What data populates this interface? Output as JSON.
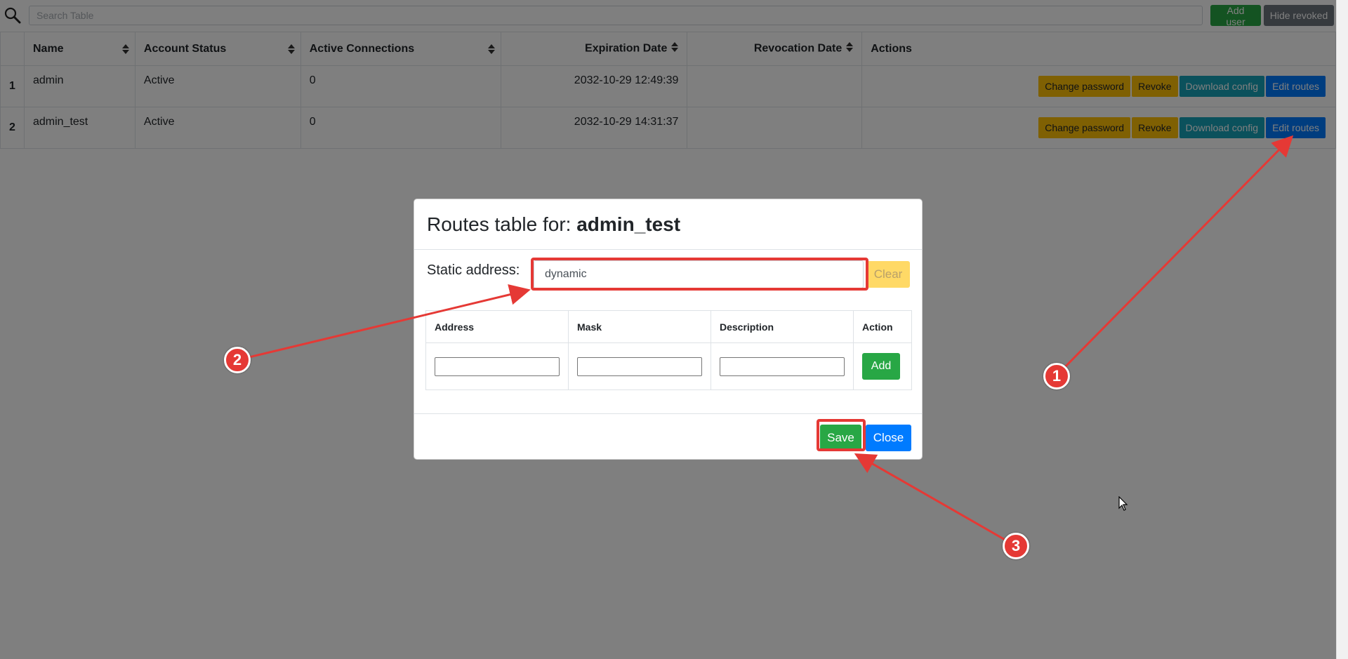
{
  "toolbar": {
    "search_placeholder": "Search Table",
    "add_user_label": "Add user",
    "hide_revoked_label": "Hide revoked"
  },
  "users_table": {
    "columns": [
      "Name",
      "Account Status",
      "Active Connections",
      "Expiration Date",
      "Revocation Date",
      "Actions"
    ],
    "rows": [
      {
        "index": "1",
        "name": "admin",
        "status": "Active",
        "connections": "0",
        "expiration": "2032-10-29 12:49:39",
        "revocation": ""
      },
      {
        "index": "2",
        "name": "admin_test",
        "status": "Active",
        "connections": "0",
        "expiration": "2032-10-29 14:31:37",
        "revocation": ""
      }
    ],
    "action_buttons": {
      "change_password": "Change password",
      "revoke": "Revoke",
      "download_config": "Download config",
      "edit_routes": "Edit routes"
    }
  },
  "modal": {
    "title_prefix": "Routes table for:",
    "title_user": "admin_test",
    "static_label": "Static address:",
    "static_value": "dynamic",
    "clear_label": "Clear",
    "routes_columns": [
      "Address",
      "Mask",
      "Description",
      "Action"
    ],
    "add_label": "Add",
    "save_label": "Save",
    "close_label": "Close"
  },
  "annotations": {
    "markers": [
      "1",
      "2",
      "3"
    ],
    "color": "#e53935"
  }
}
